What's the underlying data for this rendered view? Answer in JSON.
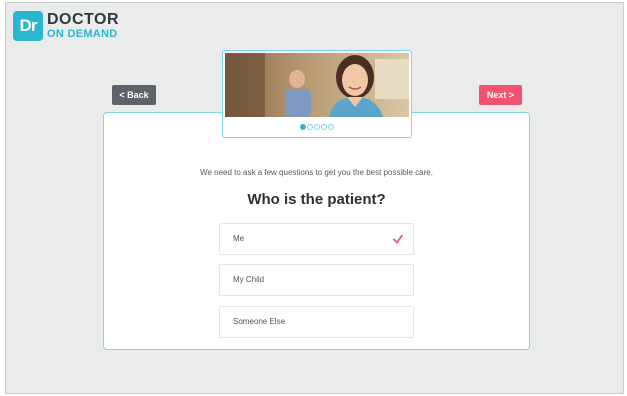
{
  "logo": {
    "mark": "Dr",
    "line1": "DOCTOR",
    "line2": "ON DEMAND",
    "colors": {
      "brand": "#29b7cf",
      "dark": "#2f3a41"
    }
  },
  "nav": {
    "back_label": "< Back",
    "next_label": "Next >",
    "colors": {
      "back": "#5f6369",
      "next": "#f1536e"
    }
  },
  "carousel": {
    "steps_total": 5,
    "current_step": 1,
    "image_icon": "doctor-photo"
  },
  "intro_text": "We need to ask a few questions to get you the best possible care.",
  "question": "Who is the patient?",
  "options": [
    {
      "label": "Me",
      "selected": true
    },
    {
      "label": "My Child",
      "selected": false
    },
    {
      "label": "Someone Else",
      "selected": false
    }
  ],
  "colors": {
    "accent": "#29b7cf",
    "check": "#f1536e",
    "background": "#e9eceb"
  }
}
